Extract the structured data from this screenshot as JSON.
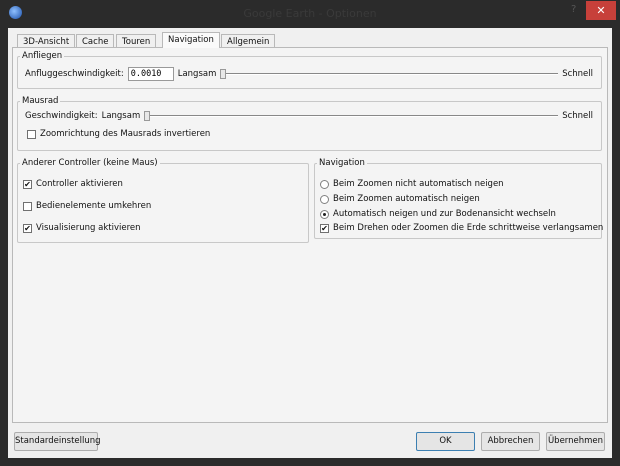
{
  "window": {
    "title": "Google Earth - Optionen",
    "help": "?",
    "close": "✕"
  },
  "tabs": [
    "3D-Ansicht",
    "Cache",
    "Touren",
    "Navigation",
    "Allgemein"
  ],
  "active_tab": "Navigation",
  "anfliegen": {
    "legend": "Anfliegen",
    "label": "Anfluggeschwindigkeit:",
    "value": "0.0010",
    "slow": "Langsam",
    "fast": "Schnell",
    "slider_value": 0
  },
  "mausrad": {
    "legend": "Mausrad",
    "label": "Geschwindigkeit:",
    "slow": "Langsam",
    "fast": "Schnell",
    "slider_value": 0,
    "invert_label": "Zoomrichtung des Mausrads invertieren",
    "invert_checked": false
  },
  "controller": {
    "legend": "Anderer Controller (keine Maus)",
    "items": [
      {
        "label": "Controller aktivieren",
        "checked": true
      },
      {
        "label": "Bedienelemente umkehren",
        "checked": false
      },
      {
        "label": "Visualisierung aktivieren",
        "checked": true
      }
    ]
  },
  "navigation": {
    "legend": "Navigation",
    "radios": [
      "Beim Zoomen nicht automatisch neigen",
      "Beim Zoomen automatisch neigen",
      "Automatisch neigen und zur Bodenansicht wechseln"
    ],
    "selected": 2,
    "slowdown_label": "Beim Drehen oder Zoomen die Erde schrittweise verlangsamen",
    "slowdown_checked": true
  },
  "buttons": {
    "default": "Standardeinstellung",
    "ok": "OK",
    "cancel": "Abbrechen",
    "apply": "Übernehmen"
  }
}
